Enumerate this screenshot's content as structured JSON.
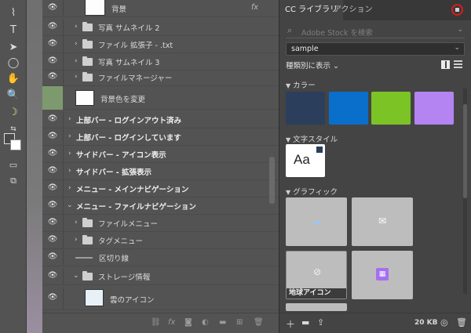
{
  "toolbar": {
    "tools": [
      "selection-tool",
      "type-tool",
      "direct-select-tool",
      "ellipse-tool",
      "hand-tool",
      "zoom-tool",
      "banana-tool",
      "default-colors",
      "swap-colors",
      "color-swatches",
      "quick-mask",
      "screen-mode"
    ]
  },
  "layers": {
    "rows": [
      {
        "label": "背景",
        "fx": "fx"
      },
      {
        "label": "写真 サムネイル 2"
      },
      {
        "label": "ファイル 拡張子 - .txt"
      },
      {
        "label": "写真 サムネイル 3"
      },
      {
        "label": "ファイルマネージャー"
      },
      {
        "label": "背景色を変更"
      },
      {
        "label": "上部バー - ログインアウト済み"
      },
      {
        "label": "上部バー - ログインしています"
      },
      {
        "label": "サイドバー - アイコン表示"
      },
      {
        "label": "サイドバー - 拡張表示"
      },
      {
        "label": "メニュー - メインナビゲーション"
      },
      {
        "label": "メニュー - ファイルナビゲーション"
      },
      {
        "label": "ファイルメニュー"
      },
      {
        "label": "タグメニュー"
      },
      {
        "label": "区切り線"
      },
      {
        "label": "ストレージ情報"
      },
      {
        "label": "雲のアイコン"
      }
    ],
    "footer_icons": [
      "link-icon",
      "fx-icon",
      "mask-icon",
      "adjustment-icon",
      "group-icon",
      "new-layer-icon",
      "trash-icon"
    ]
  },
  "library": {
    "tabs": [
      "CC ライブラリ",
      "アクション"
    ],
    "search_placeholder": "Adobe Stock を検索",
    "selected_library": "sample",
    "view_by": "種類別に表示",
    "sections": {
      "colors": "カラー",
      "character_styles": "文字スタイル",
      "graphics": "グラフィック"
    },
    "colors": [
      "#2b3e5c",
      "#0a6fcb",
      "#7cc326",
      "#b384f2"
    ],
    "char_style_sample": "Aa",
    "graphics": [
      {
        "icon": "cloud-icon",
        "label": ""
      },
      {
        "icon": "mail-icon",
        "label": ""
      },
      {
        "icon": "globe-icon",
        "label": "地球アイコン"
      },
      {
        "icon": "calendar-icon",
        "label": ""
      }
    ],
    "footer": {
      "size": "20 KB"
    }
  }
}
